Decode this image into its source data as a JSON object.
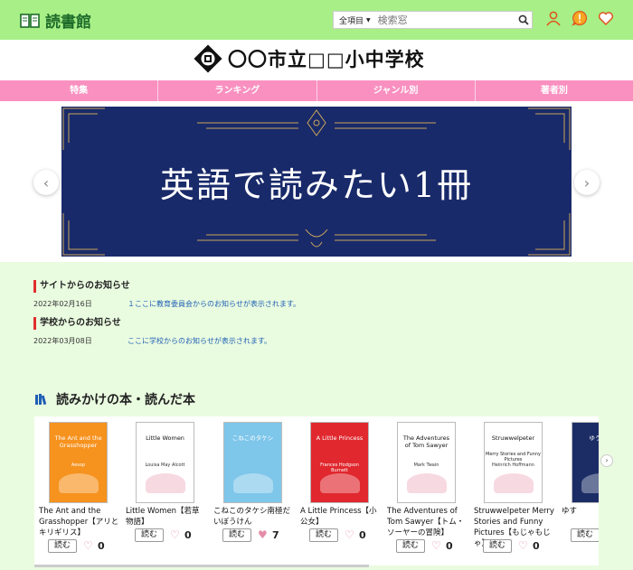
{
  "header": {
    "app_title": "読書館",
    "search": {
      "scope": "全項目",
      "placeholder": "検索窓"
    },
    "icons": [
      "user-icon",
      "alert-icon",
      "heart-icon"
    ]
  },
  "school": {
    "name": "〇〇市立□□小中学校"
  },
  "nav": [
    {
      "label": "特集"
    },
    {
      "label": "ランキング"
    },
    {
      "label": "ジャンル別"
    },
    {
      "label": "著者別"
    }
  ],
  "banner": {
    "text": "英語で読みたい1冊"
  },
  "notices": [
    {
      "heading": "サイトからのお知らせ",
      "date": "2022年02月16日",
      "text": "１ここに教育委員会からのお知らせが表示されます。"
    },
    {
      "heading": "学校からのお知らせ",
      "date": "2022年03月08日",
      "text": "ここに学校からのお知らせが表示されます。"
    }
  ],
  "shelf": {
    "title": "読みかけの本・読んだ本",
    "read_label": "読む",
    "books": [
      {
        "cover_title": "The Ant and the Grasshopper",
        "cover_author": "Aesop",
        "cover_color": "#f6921e",
        "title": "The Ant and the Grasshopper【アリとキリギリス】",
        "likes": "0",
        "liked": false
      },
      {
        "cover_title": "Little Women",
        "cover_author": "Louisa May Alcott",
        "cover_color": "#ffffff",
        "title": "Little Women【若草物語】",
        "likes": "0",
        "liked": false
      },
      {
        "cover_title": "こねこのタケシ",
        "cover_author": "",
        "cover_color": "#7ec6ea",
        "title": "こねこのタケシ南極だいぼうけん",
        "likes": "7",
        "liked": true
      },
      {
        "cover_title": "A Little Princess",
        "cover_author": "Frances Hodgson Burnett",
        "cover_color": "#e0282e",
        "title": "A Little Princess【小公女】",
        "likes": "0",
        "liked": false
      },
      {
        "cover_title": "The Adventures of Tom Sawyer",
        "cover_author": "Mark Twain",
        "cover_color": "#ffffff",
        "title": "The Adventures of Tom Sawyer【トム・ソーヤーの冒険】",
        "likes": "0",
        "liked": false
      },
      {
        "cover_title": "Struwwelpeter",
        "cover_author": "Heinrich Hoffmann",
        "cover_subtitle": "Merry Stories and Funny Pictures",
        "cover_color": "#ffffff",
        "title": "Struwwelpeter Merry Stories and Funny Pictures【もじゃもじゃ】",
        "likes": "0",
        "liked": false
      },
      {
        "cover_title": "ゆうすげ",
        "cover_author": "",
        "cover_color": "#1c2d66",
        "title": "ゆす",
        "likes": "",
        "liked": false
      }
    ]
  },
  "colors": {
    "header_bg": "#a7ef86",
    "nav_bg": "#f990c0",
    "banner_bg": "#192a6a",
    "page_bg": "#eafce0",
    "accent": "#e02f2f"
  }
}
